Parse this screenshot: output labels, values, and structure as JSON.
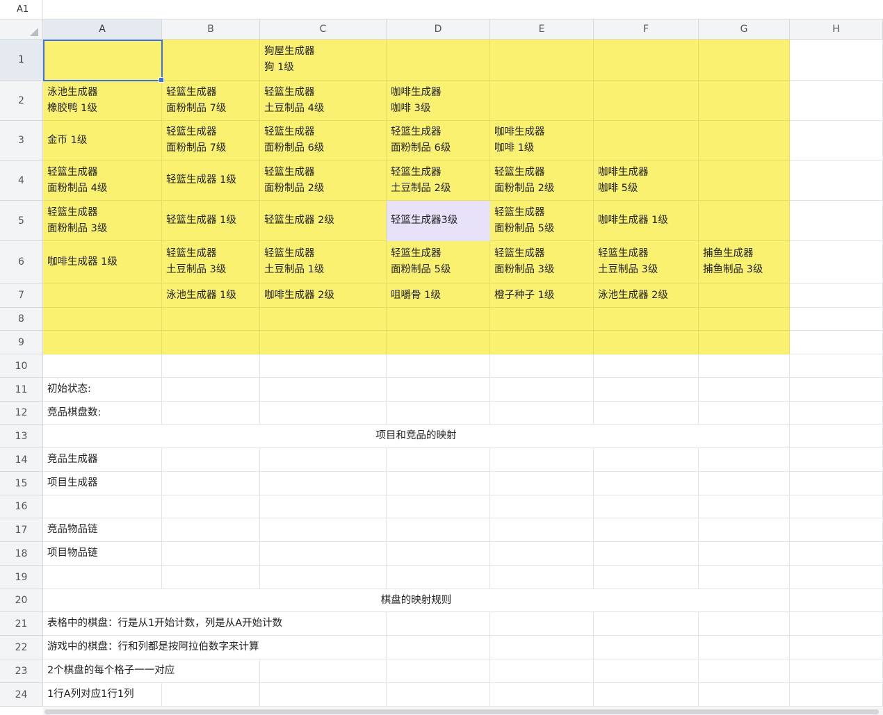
{
  "name_box": "A1",
  "columns": [
    "A",
    "B",
    "C",
    "D",
    "E",
    "F",
    "G",
    "H"
  ],
  "rows": [
    "1",
    "2",
    "3",
    "4",
    "5",
    "6",
    "7",
    "8",
    "9",
    "10",
    "11",
    "12",
    "13",
    "14",
    "15",
    "16",
    "17",
    "18",
    "19",
    "20",
    "21",
    "22",
    "23",
    "24"
  ],
  "active_cell": "A1",
  "colors": {
    "board_fill": "#fbf171",
    "highlight_fill": "#e7e1fa",
    "selection_border": "#3c6fe0",
    "header_bg": "#f3f4f6"
  },
  "board": [
    [
      "",
      "",
      "狗屋生成器\n狗 1级",
      "",
      "",
      "",
      ""
    ],
    [
      "泳池生成器\n橡胶鸭 1级",
      "轻篮生成器\n面粉制品 7级",
      "轻篮生成器\n土豆制品 4级",
      "咖啡生成器\n咖啡 3级",
      "",
      "",
      ""
    ],
    [
      "金币 1级",
      "轻篮生成器\n面粉制品 7级",
      "轻篮生成器\n面粉制品 6级",
      "轻篮生成器\n面粉制品 6级",
      "咖啡生成器\n咖啡 1级",
      "",
      ""
    ],
    [
      "轻篮生成器\n面粉制品 4级",
      "轻篮生成器 1级",
      "轻篮生成器\n面粉制品 2级",
      "轻篮生成器\n土豆制品 2级",
      "轻篮生成器\n面粉制品 2级",
      "咖啡生成器\n咖啡 5级",
      ""
    ],
    [
      "轻篮生成器\n面粉制品 3级",
      "轻篮生成器 1级",
      "轻篮生成器 2级",
      "轻篮生成器3级",
      "轻篮生成器\n面粉制品 5级",
      "咖啡生成器 1级",
      ""
    ],
    [
      "咖啡生成器 1级",
      "轻篮生成器\n土豆制品 3级",
      "轻篮生成器\n土豆制品 1级",
      "轻篮生成器\n面粉制品 5级",
      "轻篮生成器\n面粉制品 3级",
      "轻篮生成器\n土豆制品 3级",
      "捕鱼生成器\n捕鱼制品 3级"
    ],
    [
      "",
      "泳池生成器 1级",
      "咖啡生成器 2级",
      "咀嚼骨 1级",
      "橙子种子 1级",
      "泳池生成器 2级",
      ""
    ],
    [
      "",
      "",
      "",
      "",
      "",
      "",
      ""
    ],
    [
      "",
      "",
      "",
      "",
      "",
      "",
      ""
    ]
  ],
  "highlighted_cell": "D5",
  "notes": {
    "r11": "初始状态:",
    "r12": "竞品棋盘数:",
    "r13": "项目和竞品的映射",
    "r14": "竞品生成器",
    "r15": "项目生成器",
    "r17": "竞品物品链",
    "r18": "项目物品链",
    "r20": "棋盘的映射规则",
    "r21": "表格中的棋盘：行是从1开始计数，列是从A开始计数",
    "r22": "游戏中的棋盘：行和列都是按阿拉伯数字来计算",
    "r23": "2个棋盘的每个格子一一对应",
    "r24": "1行A列对应1行1列"
  }
}
